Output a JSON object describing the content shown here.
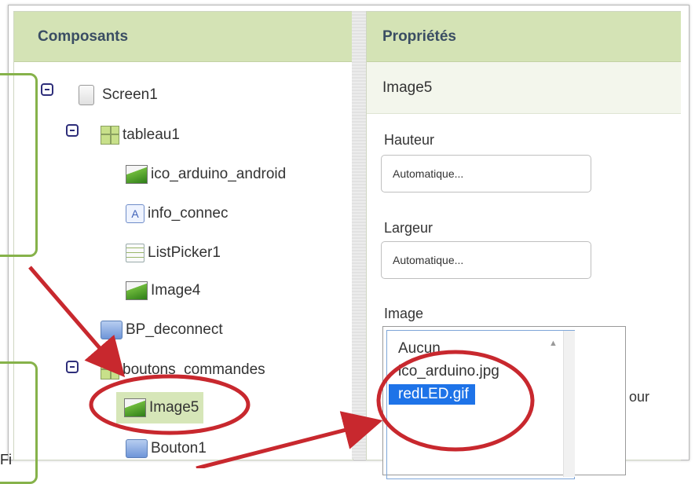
{
  "components": {
    "header": "Composants",
    "tree": [
      {
        "label": "Screen1",
        "icon": "screen-icon",
        "toggle": true
      },
      {
        "label": "tableau1",
        "icon": "table-arrangement-icon",
        "toggle": true
      },
      {
        "label": "ico_arduino_android",
        "icon": "image-icon"
      },
      {
        "label": "info_connec",
        "icon": "label-icon",
        "glyph": "A"
      },
      {
        "label": "ListPicker1",
        "icon": "list-picker-icon"
      },
      {
        "label": "Image4",
        "icon": "image-icon"
      },
      {
        "label": "BP_deconnect",
        "icon": "button-icon"
      },
      {
        "label": "boutons_commandes",
        "icon": "table-arrangement-icon",
        "toggle": true
      },
      {
        "label": "Image5",
        "icon": "image-icon",
        "selected": true
      },
      {
        "label": "Bouton1",
        "icon": "button-icon"
      }
    ]
  },
  "properties": {
    "header": "Propriétés",
    "selected_component": "Image5",
    "height_label": "Hauteur",
    "height_value": "Automatique...",
    "width_label": "Largeur",
    "width_value": "Automatique...",
    "image_label": "Image",
    "image_options": [
      "Aucun",
      "ico_arduino.jpg",
      "redLED.gif"
    ],
    "image_selected": "redLED.gif",
    "trailing_text": "our"
  },
  "stray_text": "Fi",
  "annotation_colors": {
    "arrow": "#c8282e",
    "circle": "#c8282e",
    "callout": "#86b24a",
    "selection": "#1e73e8",
    "header": "#d4e3b5"
  }
}
